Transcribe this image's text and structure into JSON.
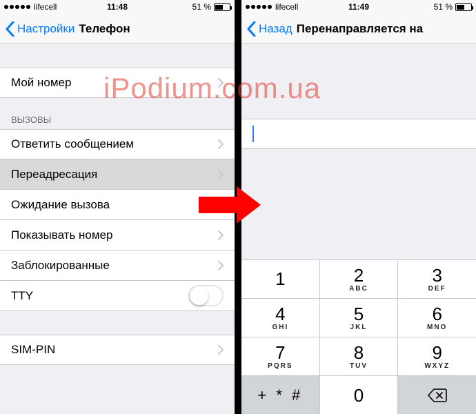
{
  "left": {
    "status": {
      "carrier": "lifecell",
      "time": "11:48",
      "battery_text": "51 %"
    },
    "nav": {
      "back": "Настройки",
      "title": "Телефон"
    },
    "my_number": "Мой номер",
    "calls_header": "ВЫЗОВЫ",
    "rows": {
      "reply": "Ответить сообщением",
      "forward": "Переадресация",
      "waiting": "Ожидание вызова",
      "showid": "Показывать номер",
      "blocked": "Заблокированные",
      "tty": "TTY",
      "simpin": "SIM-PIN"
    }
  },
  "right": {
    "status": {
      "carrier": "lifecell",
      "time": "11:49",
      "battery_text": "51 %"
    },
    "nav": {
      "back": "Назад",
      "title": "Перенаправляется на"
    },
    "input_value": "",
    "keypad": {
      "k1n": "1",
      "k1s": "",
      "k2n": "2",
      "k2s": "ABC",
      "k3n": "3",
      "k3s": "DEF",
      "k4n": "4",
      "k4s": "GHI",
      "k5n": "5",
      "k5s": "JKL",
      "k6n": "6",
      "k6s": "MNO",
      "k7n": "7",
      "k7s": "PQRS",
      "k8n": "8",
      "k8s": "TUV",
      "k9n": "9",
      "k9s": "WXYZ",
      "kstar": "+ * #",
      "k0n": "0"
    }
  },
  "watermark": "iPodium.com.ua"
}
